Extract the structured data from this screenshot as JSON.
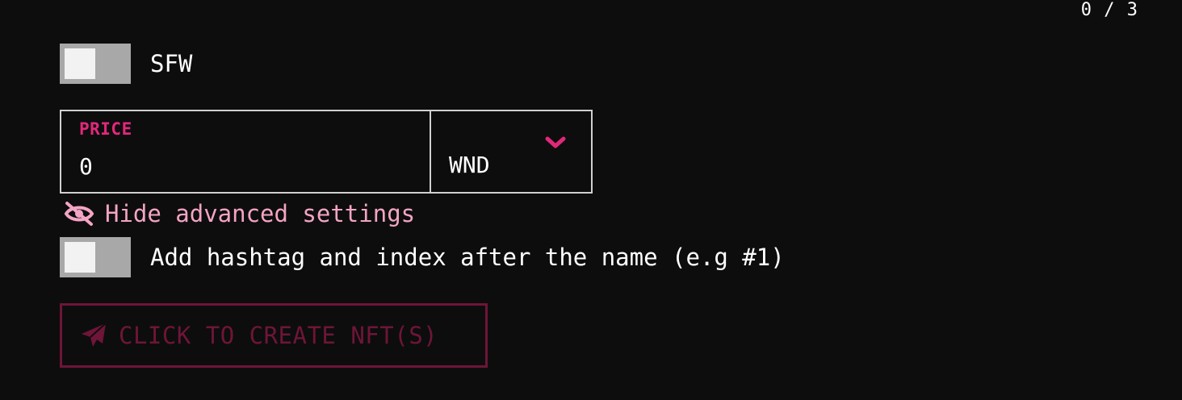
{
  "counter": "0 / 3",
  "sfw_toggle": {
    "label": "SFW",
    "checked": false
  },
  "price": {
    "label": "PRICE",
    "value": "0",
    "currency": "WND"
  },
  "advanced": {
    "label": "Hide advanced settings"
  },
  "hashtag_toggle": {
    "label": "Add hashtag and index after the name (e.g #1)",
    "checked": false
  },
  "create_button": {
    "label": "CLICK TO CREATE NFT(S)",
    "disabled": true
  },
  "colors": {
    "background": "#0d0d0d",
    "accent": "#e0287a",
    "accent_light": "#f4a4c4",
    "disabled_accent": "#6e1538",
    "toggle_track": "#a8a8a8",
    "border": "#d0d0d0"
  },
  "icons": {
    "currency_dropdown": "chevron-down-icon",
    "advanced": "eye-slash-icon",
    "create": "paper-plane-icon"
  }
}
